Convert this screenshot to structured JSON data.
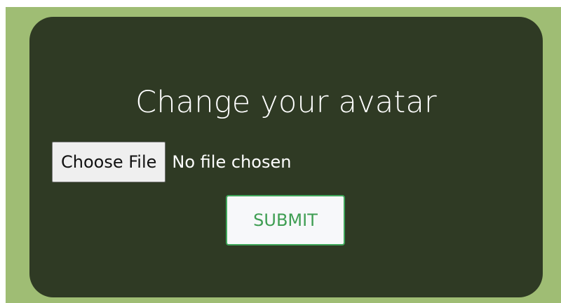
{
  "form": {
    "title": "Change your avatar",
    "file_input": {
      "button_label": "Choose File",
      "status_text": "No file chosen"
    },
    "submit_label": "SUBMIT"
  },
  "colors": {
    "page_background": "#9fbd74",
    "card_background": "#2f3a24",
    "title_text": "#ffffff",
    "submit_accent": "#3fa65a"
  }
}
